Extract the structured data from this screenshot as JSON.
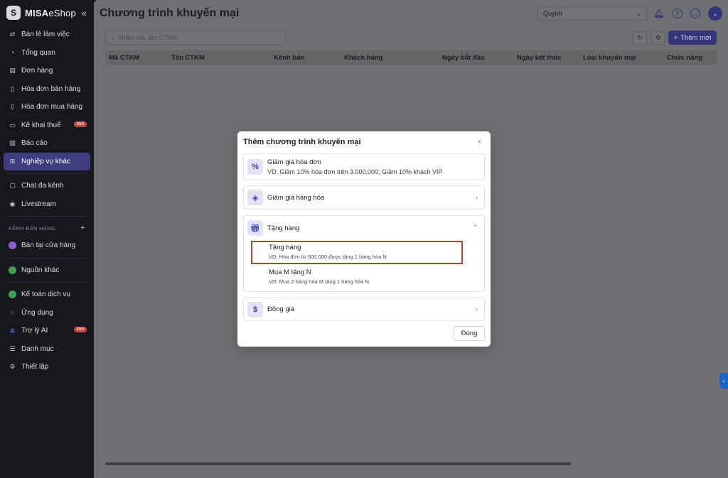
{
  "sidebar": {
    "brand_bold": "MISA",
    "brand_thin": "eShop",
    "collapse_icon": "«",
    "items": [
      {
        "label": "Bán lẻ làm việc",
        "icon": "workflow-icon"
      },
      {
        "label": "Tổng quan",
        "icon": "dashboard-icon"
      },
      {
        "label": "Đơn hàng",
        "icon": "order-icon"
      },
      {
        "label": "Hóa đơn bán hàng",
        "icon": "invoice-icon"
      },
      {
        "label": "Hóa đơn mua hàng",
        "icon": "purchase-invoice-icon"
      },
      {
        "label": "Kê khai thuế",
        "icon": "tax-icon",
        "badge": "Mới"
      },
      {
        "label": "Báo cáo",
        "icon": "report-icon"
      },
      {
        "label": "Nghiệp vụ khác",
        "icon": "other-ops-icon",
        "active": true
      },
      {
        "label": "Chat đa kênh",
        "icon": "chat-icon"
      },
      {
        "label": "Livestream",
        "icon": "livestream-icon"
      }
    ],
    "section_title": "KÊNH BÁN HÀNG",
    "section_plus": "+",
    "channels": [
      {
        "label": "Bán tại cửa hàng",
        "color": "#8e5bd6"
      },
      {
        "label": "Nguồn khác",
        "color": "#3fa24c"
      }
    ],
    "bottom_items": [
      {
        "label": "Kế toán dịch vụ",
        "icon": "accounting-icon"
      },
      {
        "label": "Ứng dụng",
        "icon": "apps-icon"
      },
      {
        "label": "Trợ lý AI",
        "icon": "ai-icon",
        "badge": "Mới"
      },
      {
        "label": "Danh mục",
        "icon": "list-icon"
      },
      {
        "label": "Thiết lập",
        "icon": "settings-icon"
      }
    ]
  },
  "header": {
    "title": "Chương trình khuyến mại",
    "user": "Quỳnh",
    "avatar_glyph": "⌄"
  },
  "toolbar": {
    "search_placeholder": "Nhập mã, tên CTKM",
    "add_label": "Thêm mới",
    "add_plus": "+"
  },
  "table": {
    "columns": [
      "Mã CTKM",
      "Tên CTKM",
      "Kênh bán",
      "Khách hàng",
      "Ngày bắt đầu",
      "Ngày kết thúc",
      "Loại khuyến mại",
      "Chức năng"
    ]
  },
  "modal": {
    "title": "Thêm chương trình khuyến mại",
    "close_icon": "×",
    "cards": [
      {
        "title": "Giảm giá hóa đơn",
        "desc": "VD: Giảm 10% hóa đơn trên 3.000.000; Giảm 10% khách VIP"
      },
      {
        "title": "Giảm giá hàng hóa"
      },
      {
        "title": "Tặng hàng",
        "sub": [
          {
            "title": "Tặng hàng",
            "desc": "VD: Hóa đơn từ 500.000 được tặng 1 hàng hóa N"
          },
          {
            "title": "Mua M tặng N",
            "desc": "VD: Mua 2 hàng hóa M tặng 1 hàng hóa N"
          }
        ]
      },
      {
        "title": "Đồng giá"
      }
    ],
    "close_button": "Đóng"
  },
  "colors": {
    "accent": "#34347a",
    "highlight": "#d7322e",
    "badge": "#c9453e"
  }
}
